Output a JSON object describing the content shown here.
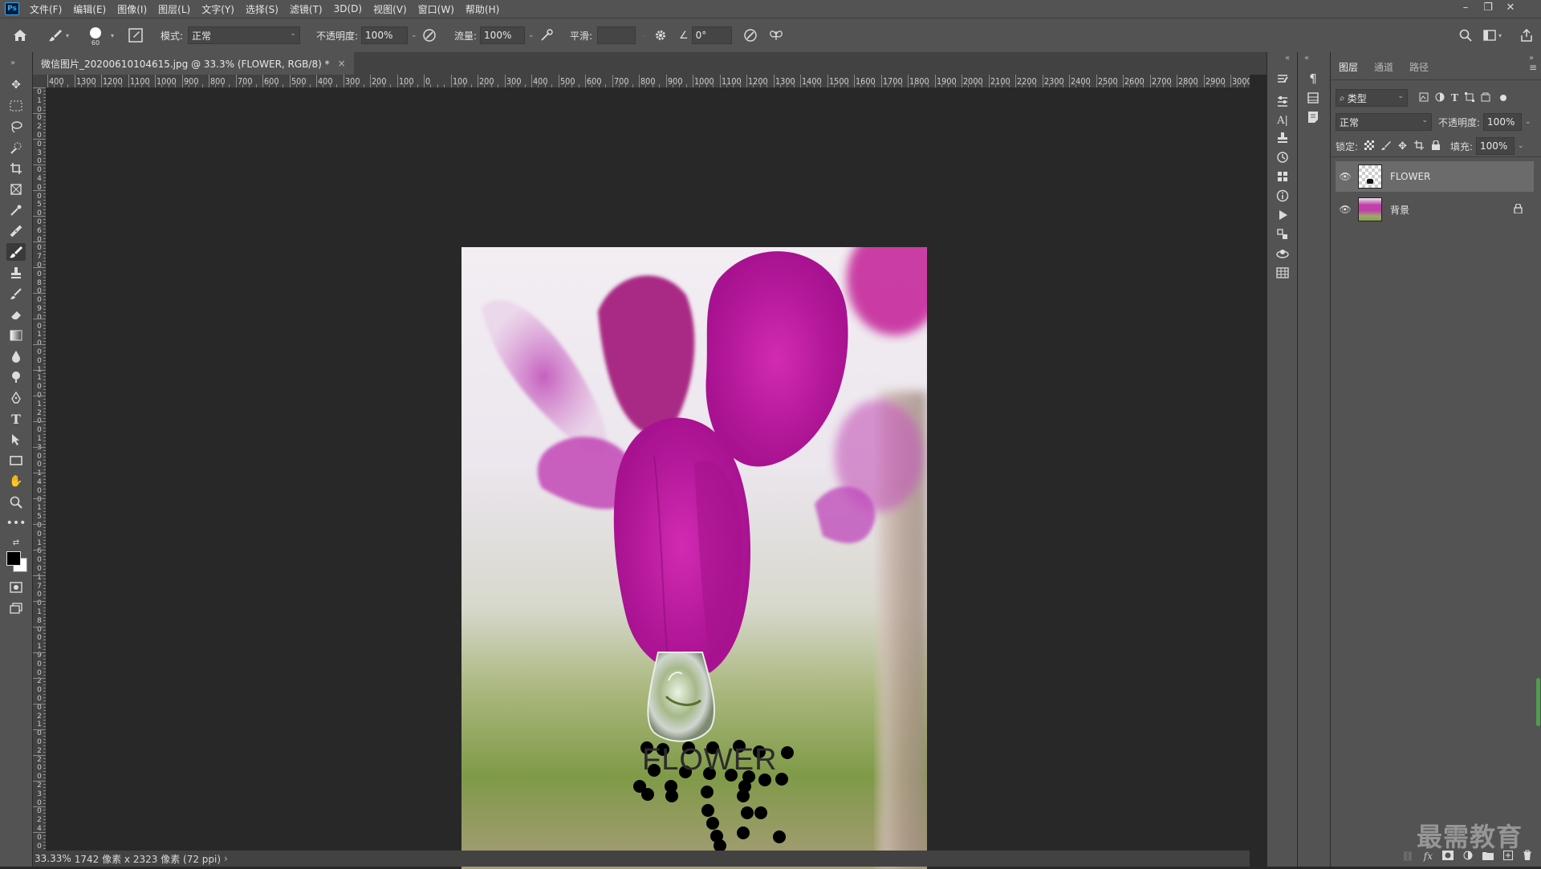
{
  "menu": {
    "items": [
      "文件(F)",
      "编辑(E)",
      "图像(I)",
      "图层(L)",
      "文字(Y)",
      "选择(S)",
      "滤镜(T)",
      "3D(D)",
      "视图(V)",
      "窗口(W)",
      "帮助(H)"
    ],
    "app_logo": "Ps"
  },
  "options": {
    "brush_size": "60",
    "mode_label": "模式:",
    "mode_value": "正常",
    "opacity_label": "不透明度:",
    "opacity_value": "100%",
    "flow_label": "流量:",
    "flow_value": "100%",
    "smoothing_label": "平滑:",
    "smoothing_value": "",
    "angle_value": "0°"
  },
  "document": {
    "tab_title": "微信图片_20200610104615.jpg @ 33.3% (FLOWER, RGB/8) *",
    "close": "×"
  },
  "ruler": {
    "horizontal": [
      "400",
      "1300",
      "1200",
      "1100",
      "1000",
      "900",
      "800",
      "700",
      "600",
      "500",
      "400",
      "300",
      "200",
      "100",
      "0",
      "100",
      "200",
      "300",
      "400",
      "500",
      "600",
      "700",
      "800",
      "900",
      "1000",
      "1100",
      "1200",
      "1300",
      "1400",
      "1500",
      "1600",
      "1700",
      "1800",
      "1900",
      "2000",
      "2100",
      "2200",
      "2300",
      "2400",
      "2500",
      "2600",
      "2700",
      "2800",
      "2900",
      "3000"
    ],
    "vertical": [
      "0",
      "1",
      "0",
      "0",
      "2",
      "0",
      "0",
      "3",
      "0",
      "0",
      "4",
      "0",
      "0",
      "5",
      "0",
      "0",
      "6",
      "0",
      "0",
      "7",
      "0",
      "0",
      "8",
      "0",
      "0",
      "9",
      "0",
      "0",
      "1",
      "0",
      "0",
      "0",
      "1",
      "1",
      "0",
      "0",
      "1",
      "2",
      "0",
      "0",
      "1",
      "3",
      "0",
      "0",
      "1",
      "4",
      "0",
      "0",
      "1",
      "5",
      "0",
      "0",
      "1",
      "6",
      "0",
      "0",
      "1",
      "7",
      "0",
      "0",
      "1",
      "8",
      "0",
      "0",
      "1",
      "9",
      "0",
      "0",
      "2",
      "0",
      "0",
      "0",
      "2",
      "1",
      "0",
      "0",
      "2",
      "2",
      "0",
      "0",
      "2",
      "3",
      "0",
      "0",
      "2",
      "4",
      "0",
      "0"
    ]
  },
  "canvas": {
    "text_layer_content": "FLOWER"
  },
  "status": {
    "zoom": "33.33%",
    "info": "1742 像素 x 2323 像素 (72 ppi)",
    "arrow": "›"
  },
  "layers_panel": {
    "tabs": [
      "图层",
      "通道",
      "路径"
    ],
    "filter_label": "类型",
    "blend_mode": "正常",
    "opacity_label": "不透明度:",
    "opacity_value": "100%",
    "lock_label": "锁定:",
    "fill_label": "填充:",
    "fill_value": "100%",
    "layers": [
      {
        "name": "FLOWER",
        "selected": true,
        "locked": false
      },
      {
        "name": "背景",
        "selected": false,
        "locked": true
      }
    ]
  },
  "watermark": "最需教育",
  "colors": {
    "accent": "#31a8ff",
    "flower_magenta": "#c41fa8",
    "background_ui": "#535353"
  }
}
